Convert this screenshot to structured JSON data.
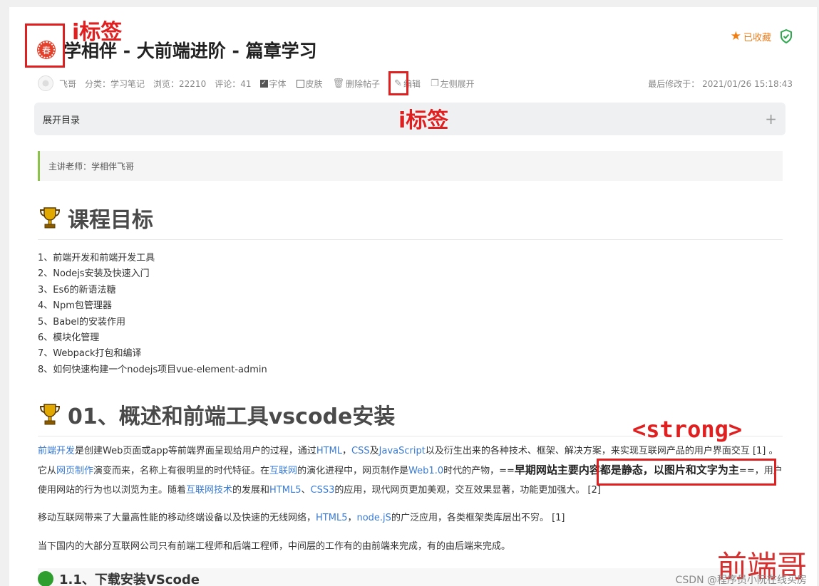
{
  "header": {
    "seal_text": "春",
    "title": "学相伴 - 大前端进阶 - 篇章学习",
    "favorite_label": "已收藏"
  },
  "meta": {
    "author": "飞哥",
    "category": "分类：学习笔记",
    "views": "浏览：22210",
    "comments": "评论：41",
    "font_label": "字体",
    "skin_label": "皮肤",
    "delete_label": "删除帖子",
    "edit_label": "编辑",
    "expand_label": "左侧展开",
    "modified": "最后修改于：  2021/01/26 15:18:43"
  },
  "toc": {
    "label": "展开目录",
    "plus": "+"
  },
  "quote": "主讲老师：学相伴飞哥",
  "section1": {
    "heading": "课程目标",
    "items": [
      "1、前端开发和前端开发工具",
      "2、Nodejs安装及快速入门",
      "3、Es6的新语法糖",
      "4、Npm包管理器",
      "5、Babel的安装作用",
      "6、模块化管理",
      "7、Webpack打包和编译",
      "8、如何快速构建一个nodejs项目vue-element-admin"
    ]
  },
  "section2": {
    "heading": "01、概述和前端工具vscode安装",
    "p1": {
      "a1": "前端开发",
      "t1": "是创建Web页面或app等前端界面呈现给用户的过程，通过",
      "a2": "HTML",
      "t2": "，",
      "a3": "CSS",
      "t3": "及",
      "a4": "JavaScript",
      "t4": "以及衍生出来的各种技术、框架、解决方案，来实现互联网产品的用户界面交互 [1] 。它从",
      "a5": "网页制作",
      "t5": "演变而来，名称上有很明显的时代特征。在",
      "a6": "互联网",
      "t6": "的演化进程中，网页制作是",
      "a7": "Web1.0",
      "t7": "时代的产物，==",
      "strong": "早期网站主要内容都是静态，以图片和文字为主",
      "t8": "==，用户使用网站的行为也以浏览为主。随着",
      "a8": "互联网技术",
      "t9": "的发展和",
      "a9": "HTML5",
      "t10": "、",
      "a10": "CSS3",
      "t11": "的应用，现代网页更加美观，交互效果显著，功能更加强大。 [2]"
    },
    "p2": {
      "t1": "移动互联网带来了大量高性能的移动终端设备以及快速的无线网络，",
      "a1": "HTML5",
      "t2": "，",
      "a2": "node.jS",
      "t3": "的广泛应用，各类框架类库层出不穷。 [1]"
    },
    "p3": "当下国内的大部分互联网公司只有前端工程师和后端工程师，中间层的工作有的由前端来完成，有的由后端来完成。",
    "sub_heading": "1.1、下载安装VScode"
  },
  "annotations": {
    "i_tag_1": "i标签",
    "i_tag_2": "i标签",
    "strong_tag": "<strong>"
  },
  "watermark": {
    "big": "前端哥",
    "small": "CSDN @程序员小阮在线买房"
  },
  "colors": {
    "accent_orange": "#ef7d10",
    "link_blue": "#3a7bd5",
    "annotation_red": "#e02020",
    "quote_bar_green": "#8bc34a"
  }
}
